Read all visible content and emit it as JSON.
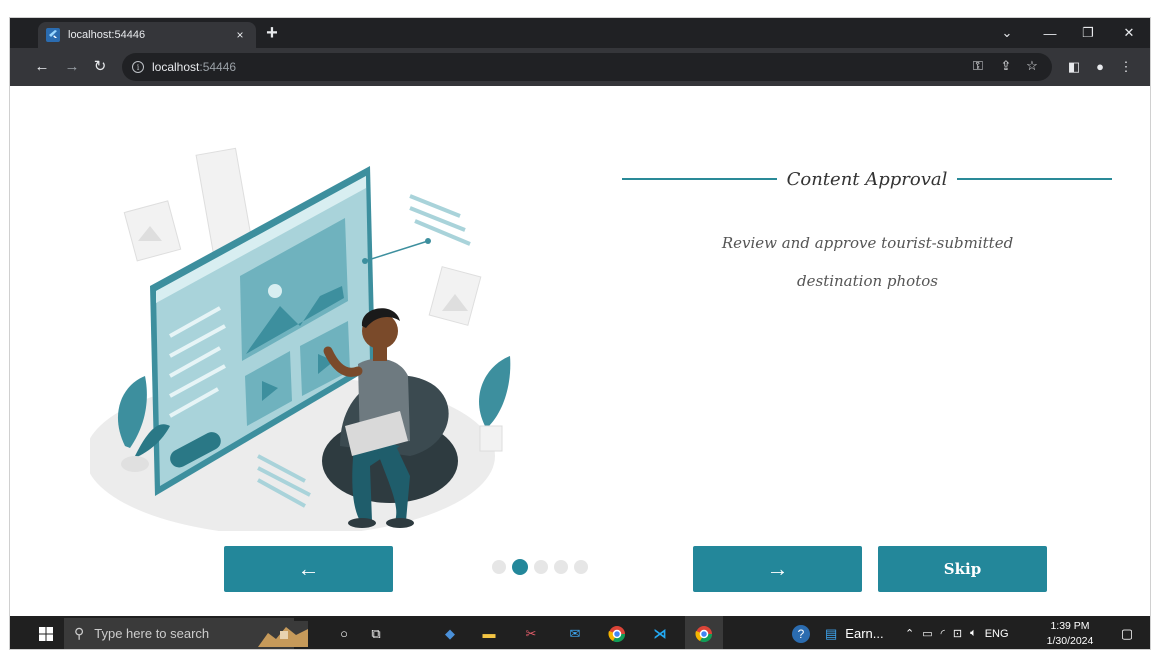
{
  "browser": {
    "tab_title": "localhost:54446",
    "tab_close": "×",
    "new_tab": "+",
    "url_host": "localhost",
    "url_port": ":54446"
  },
  "slide": {
    "title": "Content Approval",
    "description": "Review and approve tourist-submitted destination photos",
    "dots_total": 5,
    "active_dot": 1
  },
  "buttons": {
    "prev_label": "←",
    "next_label": "→",
    "skip_label": "Skip"
  },
  "taskbar": {
    "search_placeholder": "Type here to search",
    "pinned_label": "Earn...",
    "language": "ENG",
    "time": "1:39 PM",
    "date": "1/30/2024"
  },
  "colors": {
    "accent": "#23879a",
    "browser_dark": "#202124",
    "browser_toolbar": "#35363a"
  }
}
